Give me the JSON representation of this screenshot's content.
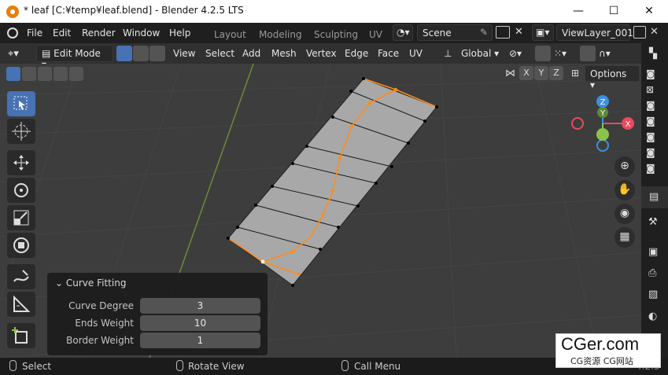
{
  "window": {
    "title": "* leaf [C:¥temp¥leaf.blend] - Blender 4.2.5 LTS",
    "minimize": "—",
    "maximize": "☐",
    "close": "✕"
  },
  "menu": [
    "File",
    "Edit",
    "Render",
    "Window",
    "Help"
  ],
  "workspaces": [
    "Layout",
    "Modeling",
    "Sculpting",
    "UV"
  ],
  "scene": {
    "name": "Scene",
    "view_layer": "ViewLayer_001"
  },
  "header": {
    "mode": "Edit Mode",
    "menus": [
      "View",
      "Select",
      "Add",
      "Mesh",
      "Vertex",
      "Edge",
      "Face",
      "UV"
    ],
    "transform_orientation": "Global"
  },
  "axis_lock": [
    "X",
    "Y",
    "Z"
  ],
  "options_label": "Options",
  "gizmo": {
    "x": "X",
    "y": "Y",
    "z": "Z"
  },
  "operator_panel": {
    "title": "Curve Fitting",
    "fields": [
      {
        "label": "Curve Degree",
        "value": "3"
      },
      {
        "label": "Ends Weight",
        "value": "10"
      },
      {
        "label": "Border Weight",
        "value": "1"
      }
    ]
  },
  "status_bar": {
    "select": "Select",
    "rotate": "Rotate View",
    "menu": "Call Menu",
    "version": "4.2.5"
  },
  "watermark": {
    "main": "CGer.com",
    "sub": "CG资源 CG网站"
  },
  "colors": {
    "accent": "#4772b3",
    "selected_edge": "#ff8c1a",
    "axis_x": "#e84a5f",
    "axis_y": "#8bc34a",
    "axis_z": "#3d8fe0"
  }
}
